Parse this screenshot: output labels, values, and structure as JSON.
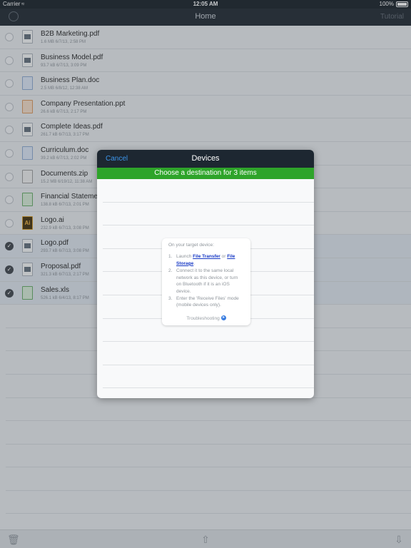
{
  "status_bar": {
    "carrier": "Carrier",
    "time": "12:05 AM",
    "battery": "100%"
  },
  "nav": {
    "title": "Home",
    "right_button": "Tutorial"
  },
  "files": [
    {
      "name": "B2B Marketing.pdf",
      "meta": "1.6 MB 6/7/13, 2:58 PM",
      "icon": "pdf-file-icon",
      "selected": false
    },
    {
      "name": "Business Model.pdf",
      "meta": "93.7 kB 6/7/13, 3:09 PM",
      "icon": "pdf-file-icon",
      "selected": false
    },
    {
      "name": "Business Plan.doc",
      "meta": "2.5 MB 6/8/12, 12:38 AM",
      "icon": "doc-file-icon",
      "selected": false
    },
    {
      "name": "Company Presentation.ppt",
      "meta": "26.6 kB 6/7/13, 2:17 PM",
      "icon": "ppt-file-icon",
      "selected": false
    },
    {
      "name": "Complete Ideas.pdf",
      "meta": "261.7 kB 6/7/13, 3:17 PM",
      "icon": "pdf-file-icon",
      "selected": false
    },
    {
      "name": "Curriculum.doc",
      "meta": "39.2 kB 6/7/13, 2:02 PM",
      "icon": "doc-file-icon",
      "selected": false
    },
    {
      "name": "Documents.zip",
      "meta": "15.2 MB 6/19/12, 11:38 AM",
      "icon": "zip-file-icon",
      "selected": false
    },
    {
      "name": "Financial Statements.xls",
      "meta": "138.8 kB 6/7/13, 2:01 PM",
      "icon": "xls-file-icon",
      "selected": false
    },
    {
      "name": "Logo.ai",
      "meta": "232.9 kB 6/7/13, 3:08 PM",
      "icon": "ai-file-icon",
      "selected": false
    },
    {
      "name": "Logo.pdf",
      "meta": "293.7 kB 6/7/13, 3:08 PM",
      "icon": "pdf-file-icon",
      "selected": true
    },
    {
      "name": "Proposal.pdf",
      "meta": "321.3 kB 6/7/13, 2:17 PM",
      "icon": "pdf-file-icon",
      "selected": true
    },
    {
      "name": "Sales.xls",
      "meta": "526.1 kB 6/4/13, 8:17 PM",
      "icon": "xls-file-icon",
      "selected": true
    }
  ],
  "toolbar": {
    "left_icon": "trash-icon",
    "center_icon": "share-icon",
    "right_icon": "download-icon"
  },
  "modal": {
    "cancel": "Cancel",
    "title": "Devices",
    "banner": "Choose a destination for 3 items",
    "card": {
      "heading": "On your target device:",
      "step1_num": "1.",
      "step1_pre": "Launch ",
      "step1_link1": "File Transfer",
      "step1_mid": " or ",
      "step1_link2": "File Storage",
      "step1_post": ".",
      "step2_num": "2.",
      "step2": "Connect it to the same local network as this device, or turn on Bluetooth if it is an iOS device.",
      "step3_num": "3.",
      "step3": "Enter the 'Receive Files' mode (mobile devices only).",
      "troubleshooting": "Troubleshooting"
    }
  },
  "colors": {
    "nav_bg": "#1b232c",
    "banner_green": "#2ea42a",
    "cancel_blue": "#3c95ea",
    "link_blue": "#1739c5"
  }
}
